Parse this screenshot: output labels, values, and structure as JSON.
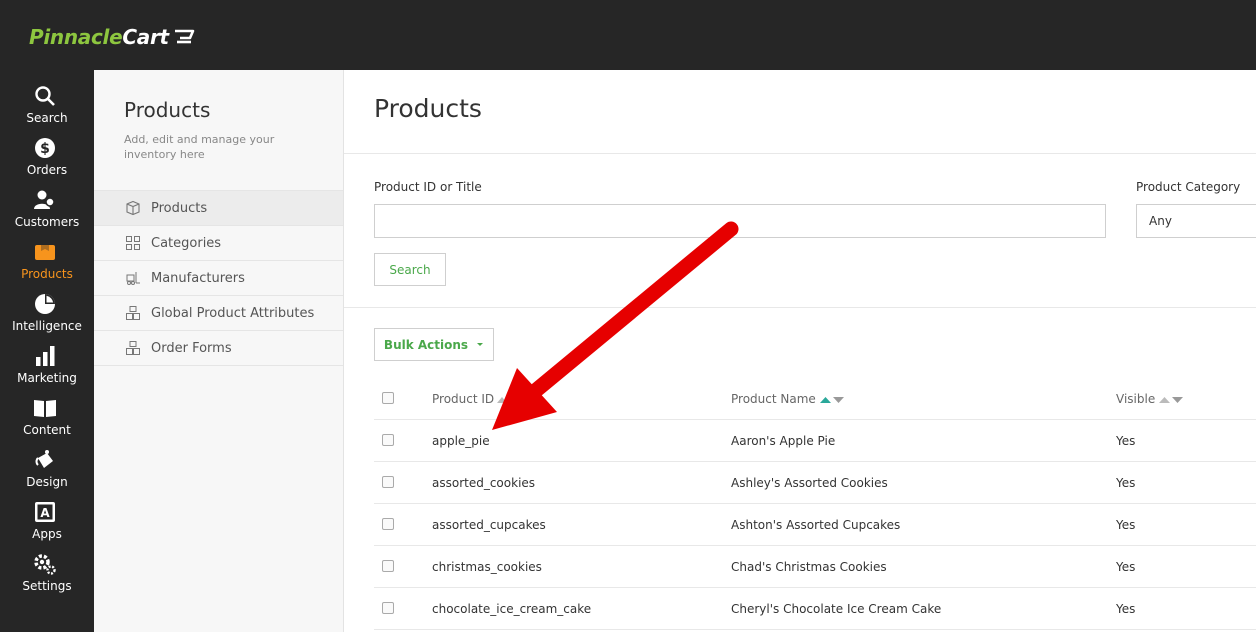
{
  "brand": {
    "name_part1": "Pinnacle",
    "name_part2": "Cart",
    "accent": "#8dc63f"
  },
  "nav": [
    {
      "label": "Search",
      "icon": "search-icon"
    },
    {
      "label": "Orders",
      "icon": "dollar-icon"
    },
    {
      "label": "Customers",
      "icon": "customers-icon"
    },
    {
      "label": "Products",
      "icon": "box-icon",
      "active": true
    },
    {
      "label": "Intelligence",
      "icon": "pie-chart-icon"
    },
    {
      "label": "Marketing",
      "icon": "bar-chart-icon"
    },
    {
      "label": "Content",
      "icon": "book-icon"
    },
    {
      "label": "Design",
      "icon": "paint-icon"
    },
    {
      "label": "Apps",
      "icon": "apps-icon"
    },
    {
      "label": "Settings",
      "icon": "gear-icon"
    }
  ],
  "subnav": {
    "title": "Products",
    "description": "Add, edit and manage your inventory here",
    "items": [
      {
        "label": "Products",
        "icon": "box-outline-icon"
      },
      {
        "label": "Categories",
        "icon": "grid-icon"
      },
      {
        "label": "Manufacturers",
        "icon": "forklift-icon"
      },
      {
        "label": "Global Product Attributes",
        "icon": "boxes-icon"
      },
      {
        "label": "Order Forms",
        "icon": "boxes-icon"
      }
    ]
  },
  "main": {
    "title": "Products",
    "search_label": "Product ID or Title",
    "search_value": "",
    "category_label": "Product Category",
    "category_value": "Any",
    "search_button": "Search",
    "bulk_actions": "Bulk Actions"
  },
  "table": {
    "headers": [
      "Product ID",
      "Product Name",
      "Visible"
    ],
    "rows": [
      {
        "id": "apple_pie",
        "name": "Aaron's Apple Pie",
        "visible": "Yes"
      },
      {
        "id": "assorted_cookies",
        "name": "Ashley's Assorted Cookies",
        "visible": "Yes"
      },
      {
        "id": "assorted_cupcakes",
        "name": "Ashton's Assorted Cupcakes",
        "visible": "Yes"
      },
      {
        "id": "christmas_cookies",
        "name": "Chad's Christmas Cookies",
        "visible": "Yes"
      },
      {
        "id": "chocolate_ice_cream_cake",
        "name": "Cheryl's Chocolate Ice Cream Cake",
        "visible": "Yes"
      }
    ]
  },
  "colors": {
    "active_nav": "#f7941d",
    "annotation_arrow": "#e60000",
    "sort_active": "#2aa89a"
  }
}
